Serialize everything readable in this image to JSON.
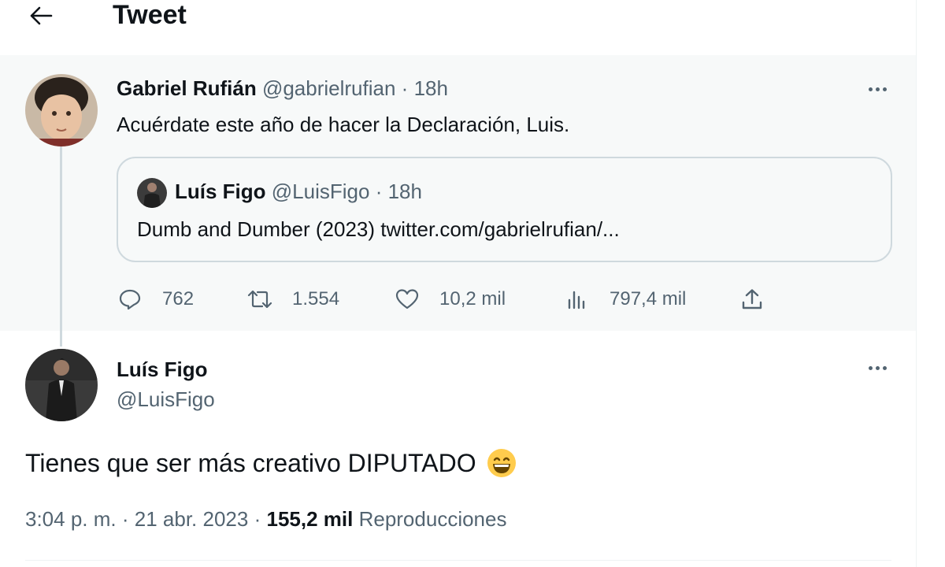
{
  "header": {
    "title": "Tweet",
    "back_icon": "arrow-left-icon"
  },
  "parent_tweet": {
    "author_name": "Gabriel Rufián",
    "author_handle": "@gabrielrufian",
    "separator": "·",
    "time": "18h",
    "text": "Acuérdate este año de hacer la Declaración, Luis.",
    "quote": {
      "author_name": "Luís Figo",
      "author_handle": "@LuisFigo",
      "separator": "·",
      "time": "18h",
      "text": "Dumb and Dumber (2023) twitter.com/gabrielrufian/..."
    },
    "stats": {
      "replies": "762",
      "retweets": "1.554",
      "likes": "10,2 mil",
      "views": "797,4 mil"
    }
  },
  "main_tweet": {
    "author_name": "Luís Figo",
    "author_handle": "@LuisFigo",
    "text": "Tienes que ser más creativo DIPUTADO",
    "emoji": "grinning-face-with-smiling-eyes",
    "time": "3:04 p. m.",
    "separator": "·",
    "date": "21 abr. 2023",
    "views_count": "155,2 mil",
    "views_label": "Reproducciones"
  },
  "colors": {
    "text_primary": "#0f1419",
    "text_secondary": "#536471",
    "parent_background": "#f7f9f9",
    "border": "#cfd9de"
  }
}
